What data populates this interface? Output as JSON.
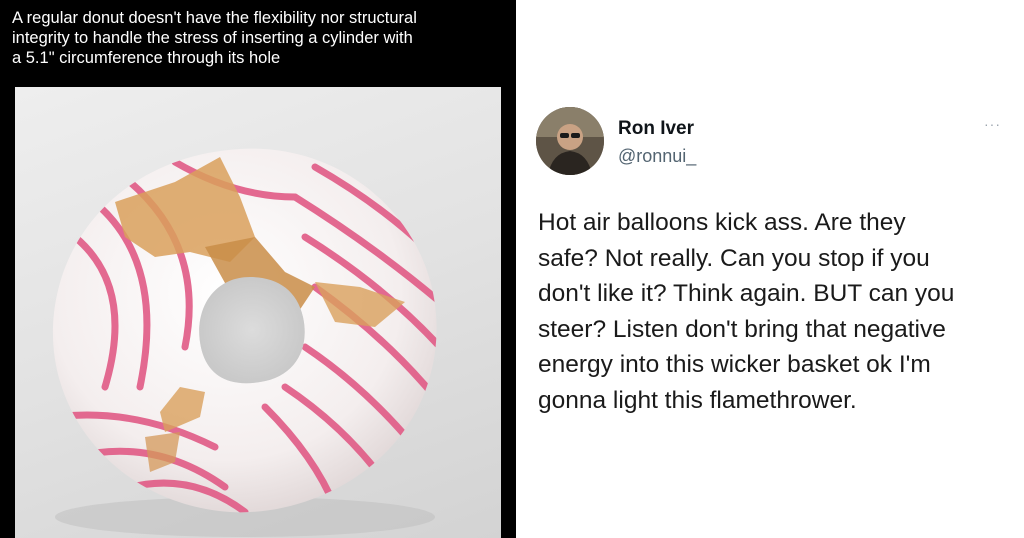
{
  "meme": {
    "caption_lines": [
      "A regular donut doesn't have the flexibility nor structural",
      "integrity to handle the stress of inserting a cylinder with",
      "a 5.1\" circumference through its hole"
    ]
  },
  "tweet": {
    "display_name": "Ron Iver",
    "handle": "@ronnui_",
    "more_icon": "···",
    "text_lines": [
      "Hot air balloons kick ass. Are they",
      "safe? Not really. Can you stop if you",
      "don't like it? Think again. BUT can you",
      "steer? Listen don't bring that negative",
      "energy into this wicker basket ok I'm",
      "gonna light this flamethrower."
    ]
  },
  "colors": {
    "left_background": "#000000",
    "donut_glaze": "#f7f3f3",
    "donut_stripe": "#e05a85",
    "donut_crumb": "#d9a05c"
  }
}
